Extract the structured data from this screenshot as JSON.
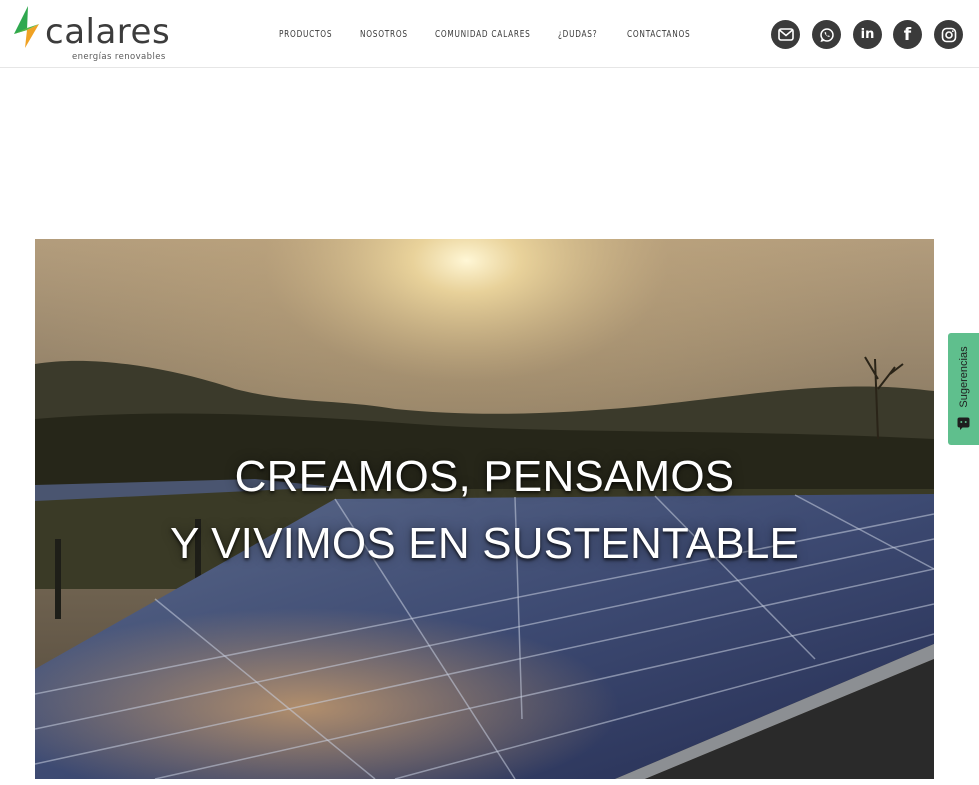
{
  "brand": {
    "name": "calares",
    "tagline": "energías renovables",
    "colors": {
      "bolt_green": "#2fa84f",
      "bolt_orange": "#f0a224",
      "text": "#3c3c3c"
    }
  },
  "nav": {
    "items": [
      {
        "label": "PRODUCTOS"
      },
      {
        "label": "NOSOTROS"
      },
      {
        "label": "COMUNIDAD CALARES"
      },
      {
        "label": "¿DUDAS?"
      },
      {
        "label": "CONTACTANOS"
      }
    ]
  },
  "social": {
    "icons": [
      "email-icon",
      "whatsapp-icon",
      "linkedin-icon",
      "facebook-icon",
      "instagram-icon"
    ],
    "linkedin_text": "in",
    "facebook_text": "f",
    "bg_color": "#3a3a3a"
  },
  "hero": {
    "line1": "CREAMOS, PENSAMOS",
    "line2": "Y VIVIMOS EN SUSTENTABLE",
    "image": "sunset-over-solar-panels"
  },
  "feedback_tab": {
    "label": "Sugerencias",
    "color": "#5fbf8d"
  }
}
